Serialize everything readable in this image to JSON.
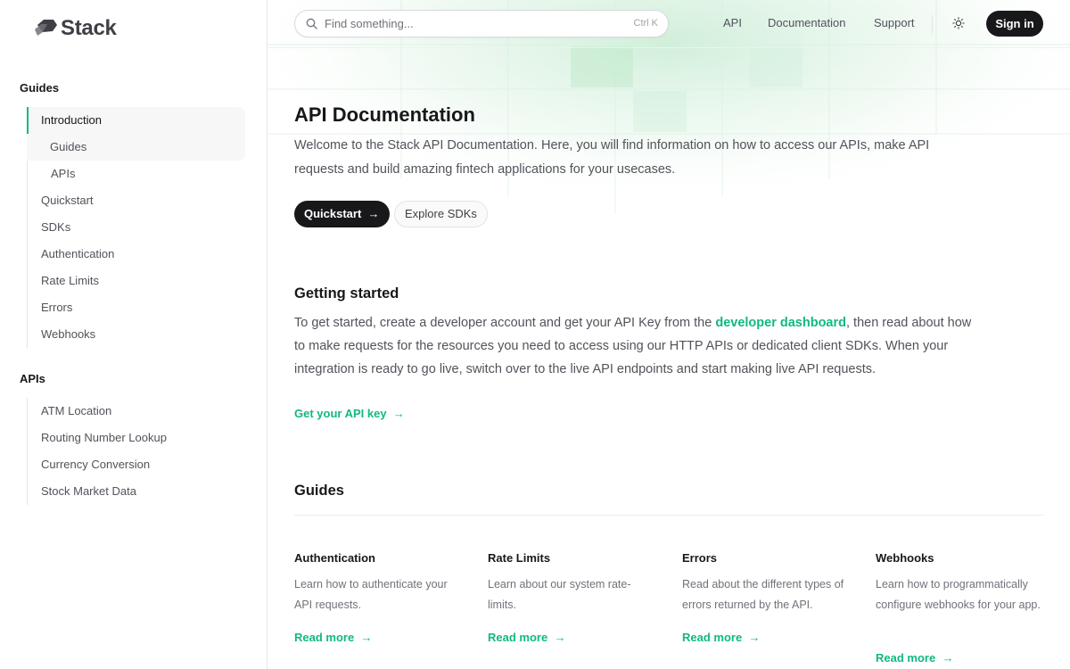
{
  "brand": {
    "name": "Stack"
  },
  "sidebar": {
    "sections": [
      {
        "heading": "Guides",
        "items": [
          {
            "label": "Introduction",
            "active": true
          },
          {
            "label": "Guides",
            "sub": true
          },
          {
            "label": "APIs",
            "sub": true
          },
          {
            "label": "Quickstart"
          },
          {
            "label": "SDKs"
          },
          {
            "label": "Authentication"
          },
          {
            "label": "Rate Limits"
          },
          {
            "label": "Errors"
          },
          {
            "label": "Webhooks"
          }
        ]
      },
      {
        "heading": "APIs",
        "items": [
          {
            "label": "ATM Location"
          },
          {
            "label": "Routing Number Lookup"
          },
          {
            "label": "Currency Conversion"
          },
          {
            "label": "Stock Market Data"
          }
        ]
      }
    ]
  },
  "header": {
    "search_placeholder": "Find something...",
    "search_shortcut": "Ctrl K",
    "nav": [
      "API",
      "Documentation",
      "Support"
    ],
    "signin_label": "Sign in"
  },
  "hero": {
    "title": "API Documentation",
    "intro": "Welcome to the Stack API Documentation. Here, you will find information on how to access our APIs, make API requests and build amazing fintech applications for your usecases.",
    "primary_button": "Quickstart",
    "secondary_button": "Explore SDKs"
  },
  "getting_started": {
    "title": "Getting started",
    "text_before": "To get started, create a developer account and get your API Key from the ",
    "link_text": "developer dashboard",
    "text_after": ", then read about how to make requests for the resources you need to access using our HTTP APIs or dedicated client SDKs. When your integration is ready to go live, switch over to the live API endpoints and start making live API requests.",
    "cta": "Get your API key"
  },
  "guides": {
    "title": "Guides",
    "cards": [
      {
        "title": "Authentication",
        "description": "Learn how to authenticate your API requests.",
        "link": "Read more"
      },
      {
        "title": "Rate Limits",
        "description": "Learn about our system rate-limits.",
        "link": "Read more"
      },
      {
        "title": "Errors",
        "description": "Read about the different types of errors returned by the API.",
        "link": "Read more"
      },
      {
        "title": "Webhooks",
        "description": "Learn how to programmatically configure webhooks for your app.",
        "link": "Read more"
      }
    ]
  },
  "icons": {
    "logo": "stack-logo-icon",
    "search": "search-icon",
    "theme": "sun-icon",
    "arrow": "arrow-right-icon"
  },
  "colors": {
    "accent": "#10b981",
    "dark": "#18181b",
    "text": "#52525b"
  }
}
